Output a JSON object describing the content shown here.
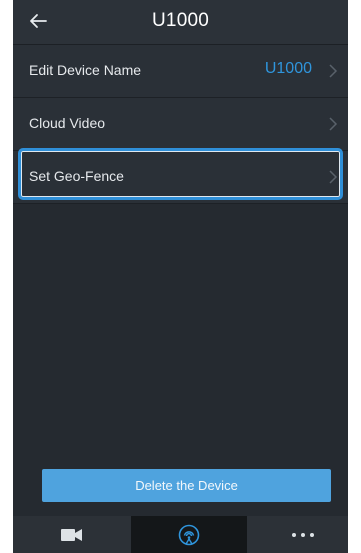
{
  "header": {
    "title": "U1000",
    "back_icon": "arrow-left-icon"
  },
  "settings": [
    {
      "label": "Edit Device Name",
      "value": "U1000",
      "icon": "chevron-right-icon"
    },
    {
      "label": "Cloud Video",
      "icon": "chevron-right-icon"
    },
    {
      "label": "Set Geo-Fence",
      "icon": "chevron-right-icon",
      "highlighted": true
    }
  ],
  "actions": {
    "delete_label": "Delete the Device"
  },
  "tabbar": {
    "tabs": [
      {
        "icon": "video-camera-icon"
      },
      {
        "icon": "signal-icon",
        "active": true
      },
      {
        "icon": "more-dots-icon"
      }
    ]
  },
  "colors": {
    "background": "#252a30",
    "accent": "#2f95dc",
    "button": "#4fa3de",
    "highlight_border": "#2f8fd8"
  }
}
